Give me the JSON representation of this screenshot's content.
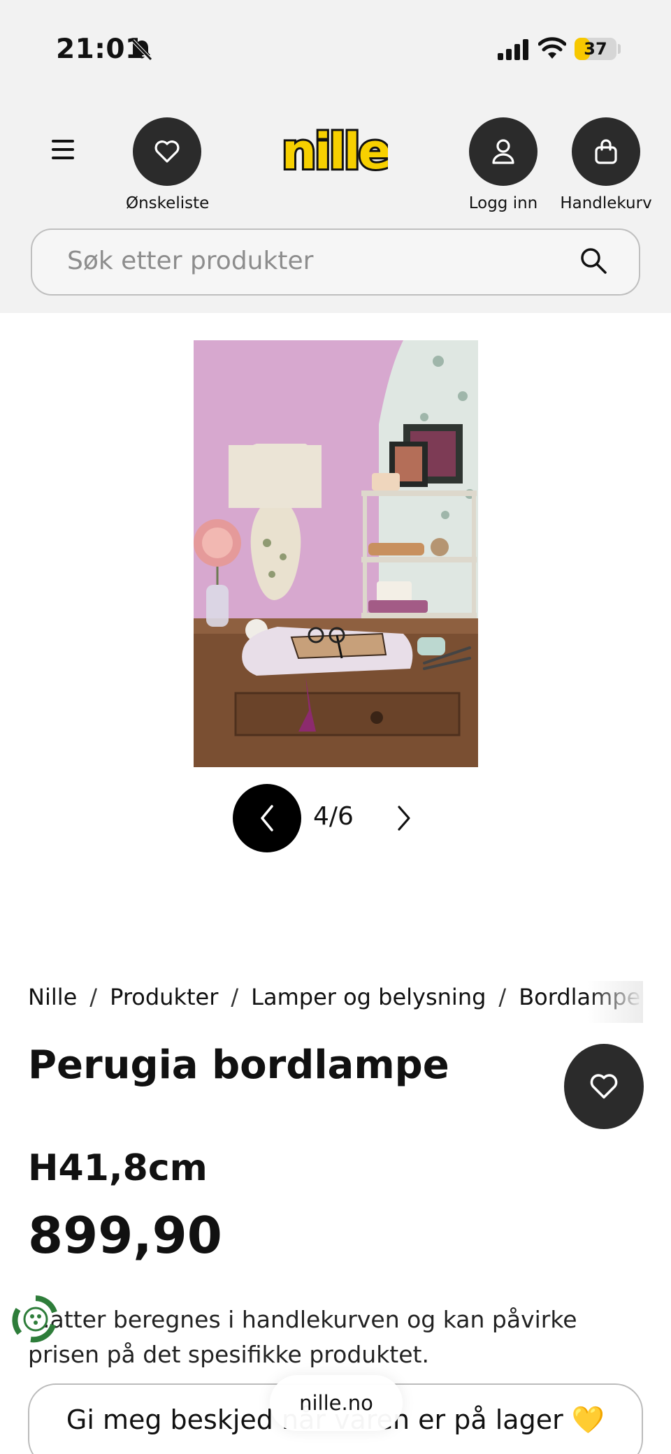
{
  "status_bar": {
    "time": "21:01",
    "battery_level": "37",
    "battery_percent": 37
  },
  "header": {
    "logo_text": "nille",
    "wishlist_label": "Ønskeliste",
    "login_label": "Logg inn",
    "cart_label": "Handlekurv"
  },
  "search": {
    "placeholder": "Søk etter produkter"
  },
  "gallery": {
    "counter": "4/6"
  },
  "breadcrumb": [
    "Nille",
    "Produkter",
    "Lamper og belysning",
    "Bordlamper"
  ],
  "product": {
    "title": "Perugia bordlampe",
    "size": "H41,8cm",
    "price": "899,90",
    "note": "...atter beregnes i handlekurven og kan påvirke prisen på det spesifikke produktet.",
    "notify_label": "Gi meg beskjed når varen er på lager 💛"
  },
  "browser": {
    "url": "nille.no"
  },
  "colors": {
    "accent_yellow": "#f7d000",
    "dark_button": "#2b2b2b",
    "background_top": "#f2f2f2"
  }
}
